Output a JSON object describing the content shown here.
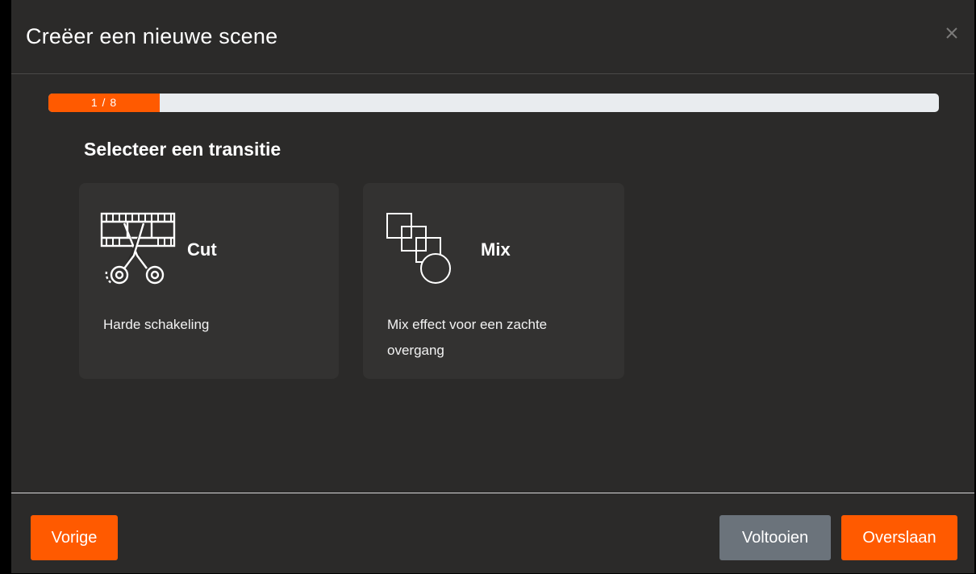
{
  "dialog": {
    "title": "Creëer een nieuwe scene",
    "close_icon": "close-icon"
  },
  "progress": {
    "label": "1 / 8",
    "current": 1,
    "total": 8,
    "fraction": 0.125,
    "color": "#ff5a00",
    "track_color": "#e9ecef"
  },
  "section": {
    "title": "Selecteer een transitie"
  },
  "options": [
    {
      "label": "Cut",
      "description": "Harde schakeling",
      "icon": "film-scissors-icon"
    },
    {
      "label": "Mix",
      "description": "Mix effect voor een zachte overgang",
      "icon": "overlapping-shapes-icon"
    }
  ],
  "footer": {
    "prev_label": "Vorige",
    "finish_label": "Voltooien",
    "skip_label": "Overslaan"
  },
  "colors": {
    "accent": "#ff5a00",
    "secondary_button": "#6b737b",
    "background": "#2b2a29",
    "card": "#333231"
  }
}
